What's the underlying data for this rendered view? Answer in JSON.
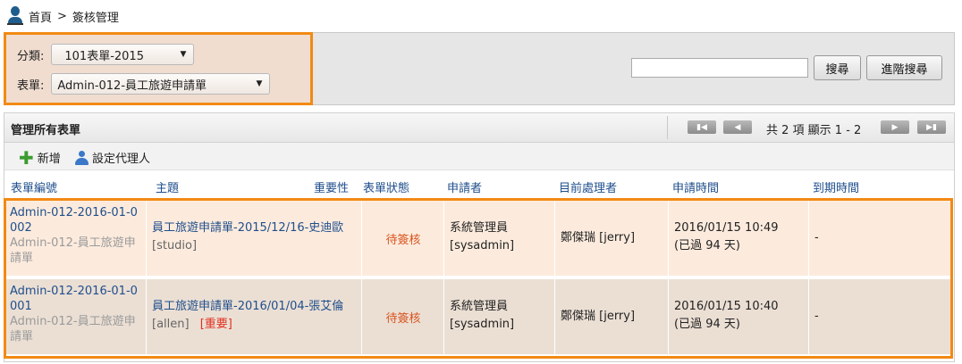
{
  "breadcrumb": {
    "home": "首頁",
    "separator": ">",
    "current": "簽核管理"
  },
  "filters": {
    "category_label": "分類:",
    "category_value": "101表單-2015",
    "form_label": "表單:",
    "form_value": "Admin-012-員工旅遊申請單"
  },
  "search": {
    "input_value": "",
    "search_label": "搜尋",
    "advanced_label": "進階搜尋"
  },
  "panel": {
    "title": "管理所有表單",
    "pager_text": "共 2 項 顯示 1 - 2",
    "pager_icons": {
      "first": "▮◀",
      "prev": "◀",
      "next": "▶",
      "last": "▶▮"
    }
  },
  "toolbar": {
    "add_label": "新增",
    "proxy_label": "設定代理人"
  },
  "columns": [
    "表單編號",
    "主題",
    "重要性",
    "表單狀態",
    "申請者",
    "目前處理者",
    "申請時間",
    "到期時間"
  ],
  "rows": [
    {
      "form_no": "Admin-012-2016-01-0002",
      "form_name": "Admin-012-員工旅遊申請單",
      "subject": "員工旅遊申請單-2015/12/16-史迪歐",
      "subject_user": "[studio]",
      "important": "",
      "status": "待簽核",
      "applicant": "系統管理員",
      "applicant_id": "[sysadmin]",
      "handler": "鄭傑瑞 [jerry]",
      "apply_time": "2016/01/15 10:49",
      "elapsed": "(已過 94 天)",
      "due": "-"
    },
    {
      "form_no": "Admin-012-2016-01-0001",
      "form_name": "Admin-012-員工旅遊申請單",
      "subject": "員工旅遊申請單-2016/01/04-張艾倫",
      "subject_user": "[allen]",
      "important": "[重要]",
      "status": "待簽核",
      "applicant": "系統管理員",
      "applicant_id": "[sysadmin]",
      "handler": "鄭傑瑞 [jerry]",
      "apply_time": "2016/01/15 10:40",
      "elapsed": "(已過 94 天)",
      "due": "-"
    }
  ],
  "colors": {
    "highlight": "#f28a14",
    "link": "#1f4e8c",
    "status": "#d9531e",
    "important": "#e03020"
  }
}
